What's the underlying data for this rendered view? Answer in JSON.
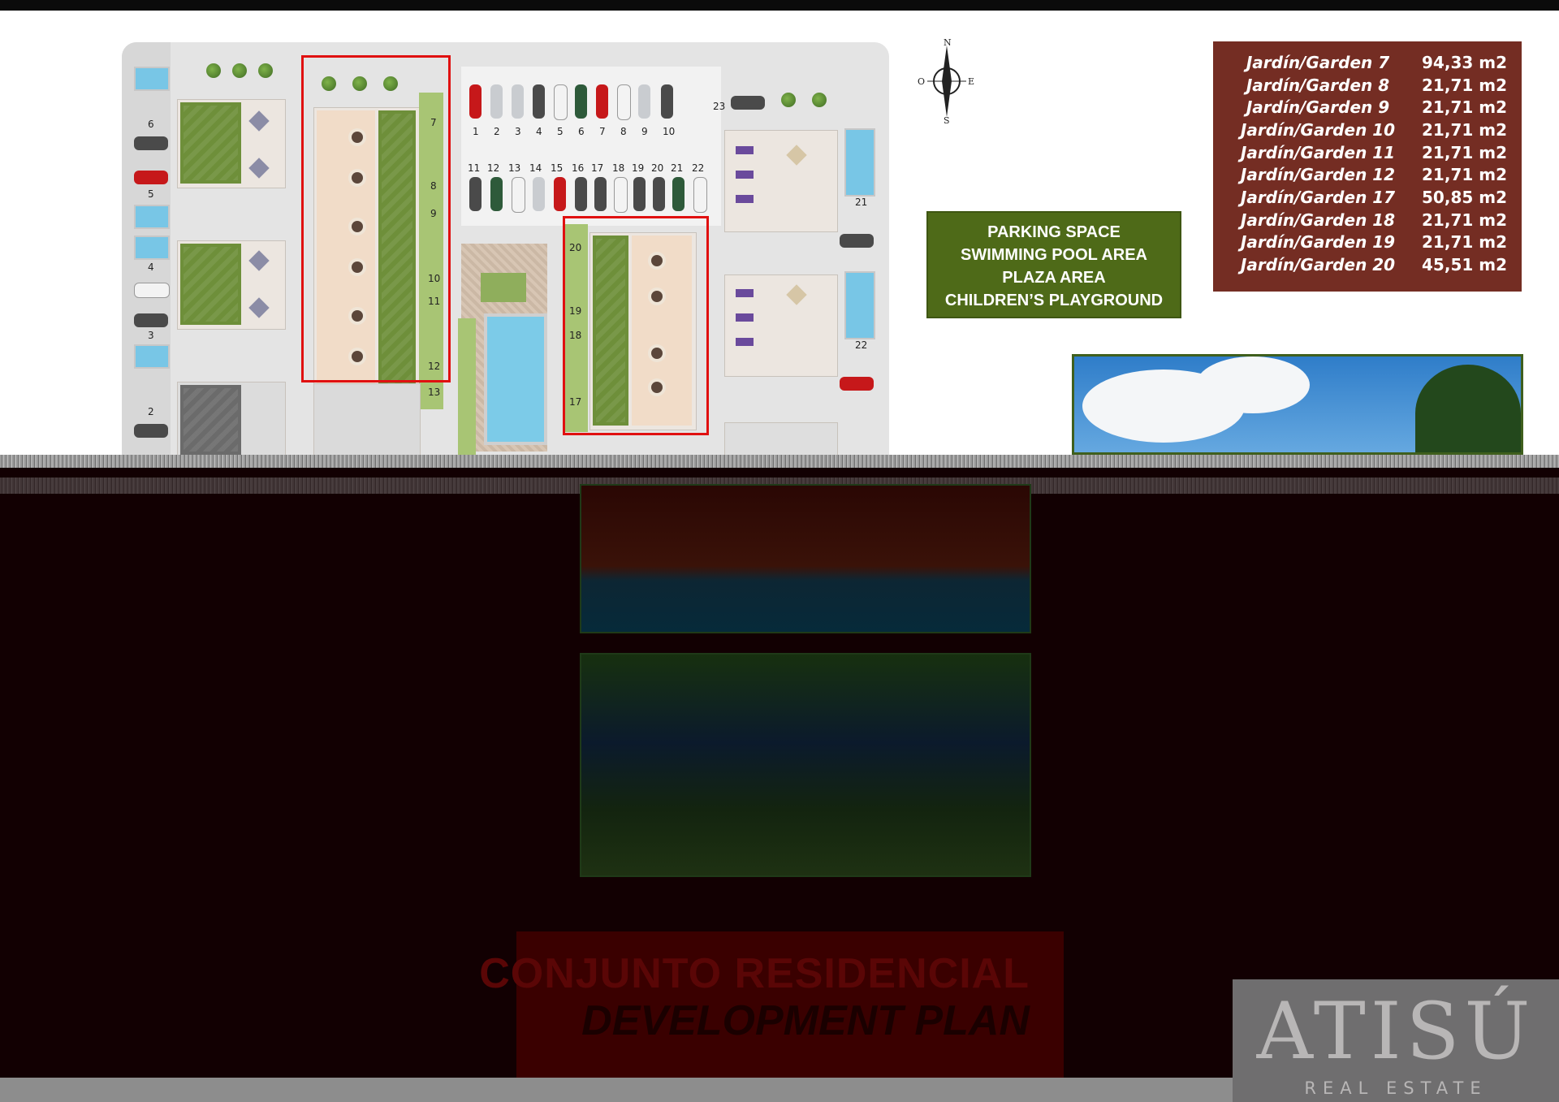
{
  "compass": {
    "n": "N",
    "s": "S",
    "e": "E",
    "o": "O"
  },
  "plan_numbers": [
    "1",
    "2",
    "3",
    "4",
    "5",
    "6",
    "7",
    "8",
    "9",
    "10",
    "11",
    "12",
    "13",
    "14",
    "15",
    "16",
    "17",
    "18",
    "19",
    "20",
    "21",
    "22",
    "23"
  ],
  "info_box": {
    "lines": [
      "PARKING SPACE",
      "SWIMMING POOL AREA",
      "PLAZA AREA",
      "CHILDREN’S PLAYGROUND"
    ]
  },
  "gardens": [
    {
      "label": "Jardín/Garden 7",
      "value": "94,33 m2"
    },
    {
      "label": "Jardín/Garden 8",
      "value": "21,71 m2"
    },
    {
      "label": "Jardín/Garden 9",
      "value": "21,71 m2"
    },
    {
      "label": "Jardín/Garden 10",
      "value": "21,71 m2"
    },
    {
      "label": "Jardín/Garden 11",
      "value": "21,71 m2"
    },
    {
      "label": "Jardín/Garden 12",
      "value": "21,71 m2"
    },
    {
      "label": "Jardín/Garden 17",
      "value": "50,85 m2"
    },
    {
      "label": "Jardín/Garden 18",
      "value": "21,71 m2"
    },
    {
      "label": "Jardín/Garden 19",
      "value": "21,71 m2"
    },
    {
      "label": "Jardín/Garden 20",
      "value": "45,51 m2"
    }
  ],
  "title": {
    "line1": "CONJUNTO RESIDENCIAL",
    "line2": "DEVELOPMENT PLAN"
  },
  "logo": {
    "word": "ATISÚ",
    "sub": "REAL ESTATE"
  },
  "colors": {
    "garden_box": "#742d23",
    "info_box": "#4e6a18",
    "highlight": "#e01010",
    "overlay": "#120002"
  }
}
